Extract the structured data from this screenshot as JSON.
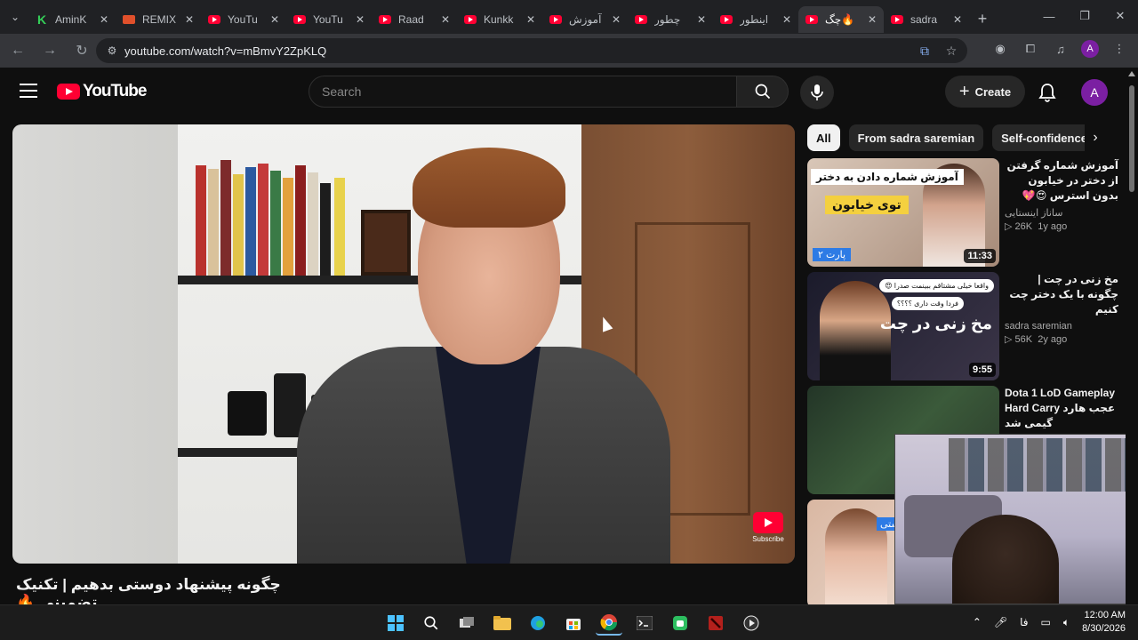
{
  "browser": {
    "tabs": [
      {
        "title": "AminK",
        "favicon": "kick-icon",
        "active": false
      },
      {
        "title": "REMIX",
        "favicon": "remix-icon",
        "active": false
      },
      {
        "title": "YouTu",
        "favicon": "youtube-icon",
        "active": false
      },
      {
        "title": "YouTu",
        "favicon": "youtube-icon",
        "active": false
      },
      {
        "title": "Raad",
        "favicon": "youtube-icon",
        "active": false
      },
      {
        "title": "Kunkk",
        "favicon": "youtube-icon",
        "active": false
      },
      {
        "title": "آموزش",
        "favicon": "youtube-icon",
        "active": false
      },
      {
        "title": "چطور",
        "favicon": "youtube-icon",
        "active": false
      },
      {
        "title": "اینطور",
        "favicon": "youtube-icon",
        "active": false
      },
      {
        "title": "چگ🔥",
        "favicon": "youtube-icon",
        "active": true
      },
      {
        "title": "sadra",
        "favicon": "youtube-icon",
        "active": false
      }
    ],
    "url": "youtube.com/watch?v=mBmvY2ZpKLQ",
    "profile_initial": "A"
  },
  "youtube": {
    "logo_text": "YouTube",
    "search_placeholder": "Search",
    "create_label": "Create",
    "avatar_initial": "A",
    "video_title": "چگونه پیشنهاد دوستی بدهیم | تکنیک تضمینی 🔥",
    "subscribe_watermark": "Subscribe",
    "chips": [
      "All",
      "From sadra saremian",
      "Self-confidence"
    ],
    "recommendations": [
      {
        "title": "آموزش شماره گرفتن از دختر در خیابون بدون استرس 😍💖",
        "channel": "ساناز اینستایی",
        "views": "26K",
        "age": "1y ago",
        "duration": "11:33",
        "thumb_banner": "آموزش شماره دادن به دختر",
        "thumb_yellow": "توی خیابون",
        "thumb_part": "پارت ۲"
      },
      {
        "title": "مخ زنی در چت | چگونه با یک دختر چت کنیم",
        "channel": "sadra saremian",
        "views": "56K",
        "age": "2y ago",
        "duration": "9:55",
        "thumb_bubble1": "واقعا خیلی مشتاقم ببینمت صدرا 😍",
        "thumb_bubble2": "فردا وقت داری ؟؟؟؟",
        "thumb_big": "مخ زنی در چت"
      },
      {
        "title": "Dota 1 LoD Gameplay Hard Carry عجب هارد گیمی شد",
        "channel": "",
        "views": "",
        "age": "",
        "duration": ""
      },
      {
        "title": "",
        "channel": "",
        "views": "",
        "age": "",
        "duration": "",
        "thumb_tag": "ستی"
      }
    ]
  },
  "taskbar": {
    "lang": "فا",
    "time": "12:00 AM",
    "date": "8/30/2026"
  }
}
